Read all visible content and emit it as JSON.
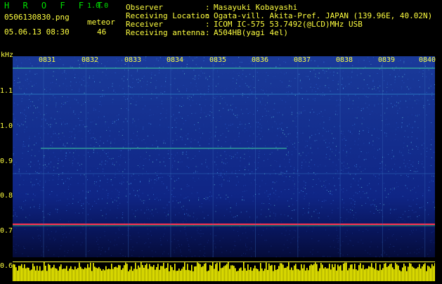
{
  "app": {
    "title": "H R O F F T",
    "version": "1.0.0"
  },
  "file_name": "0506130830.png",
  "datetime": "05.06.13 08:30",
  "meteor": {
    "label": "meteor",
    "count": "46"
  },
  "metadata": [
    {
      "key": "Observer",
      "sep": ":",
      "value": "Masayuki Kobayashi"
    },
    {
      "key": "Receiving Location",
      "sep": ":",
      "value": "Ogata-vill. Akita-Pref. JAPAN (139.96E, 40.02N)"
    },
    {
      "key": "Receiver",
      "sep": ":",
      "value": "ICOM IC-575 53.7492(@LCD)MHz USB"
    },
    {
      "key": "Receiving antenna",
      "sep": ":",
      "value": "A504HB(yagi 4el)"
    }
  ],
  "axis": {
    "unit": "kHz",
    "time_ticks": [
      "0831",
      "0832",
      "0833",
      "0834",
      "0835",
      "0836",
      "0837",
      "0838",
      "0839",
      "0840"
    ],
    "freq_ticks": [
      "1.1",
      "1.0",
      "0.9",
      "0.8",
      "0.7",
      "0.6"
    ]
  },
  "colors": {
    "text": "#ffff40",
    "title": "#00e000",
    "background": "#000000",
    "spectrogram_base": "#0a1a6a",
    "power_strip": "#ffff00"
  }
}
